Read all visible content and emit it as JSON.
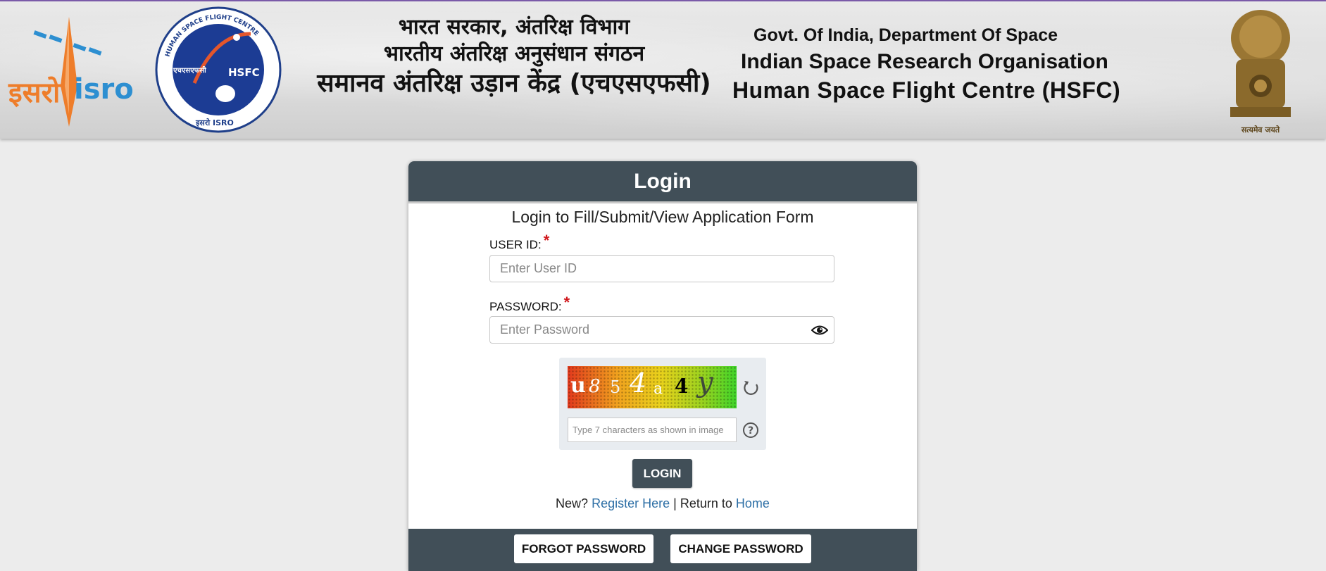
{
  "header": {
    "isro_hindi": "इसरो",
    "isro_english": "isro",
    "hindi_line1": "भारत सरकार, अंतरिक्ष विभाग",
    "hindi_line2": "भारतीय अंतरिक्ष अनुसंधान संगठन",
    "hindi_line3": "समानव अंतरिक्ष उड़ान केंद्र (एचएसएफसी)",
    "english_line1": "Govt. Of India, Department Of Space",
    "english_line2": "Indian Space Research Organisation",
    "english_line3": "Human Space Flight Centre (HSFC)",
    "hsfc_ring_text": "HUMAN SPACE FLIGHT CENTRE",
    "hsfc_center": "HSFC",
    "hsfc_hindi": "एचएसएफसी",
    "hsfc_bottom": "इसरो  ISRO",
    "emblem_motto": "सत्यमेव जयते"
  },
  "login": {
    "title": "Login",
    "subtitle": "Login to Fill/Submit/View Application Form",
    "user_label": "USER ID:",
    "user_placeholder": "Enter User ID",
    "user_value": "",
    "password_label": "PASSWORD:",
    "password_placeholder": "Enter Password",
    "password_value": "",
    "required_mark": "*",
    "captcha_text": [
      "u",
      "8",
      "5",
      "4",
      "a",
      "4",
      "y"
    ],
    "captcha_placeholder": "Type 7 characters as shown in image",
    "captcha_value": "",
    "login_button": "LOGIN",
    "new_text": "New?",
    "register_link": "Register Here",
    "separator": "|",
    "return_text": "Return to",
    "home_link": "Home",
    "forgot_button": "FORGOT PASSWORD",
    "change_button": "CHANGE PASSWORD"
  },
  "colors": {
    "header_dark": "#414f58",
    "link": "#2d6fa6",
    "required": "#d0161b",
    "isro_orange": "#ee7d2a",
    "isro_blue": "#2d8fd1"
  }
}
